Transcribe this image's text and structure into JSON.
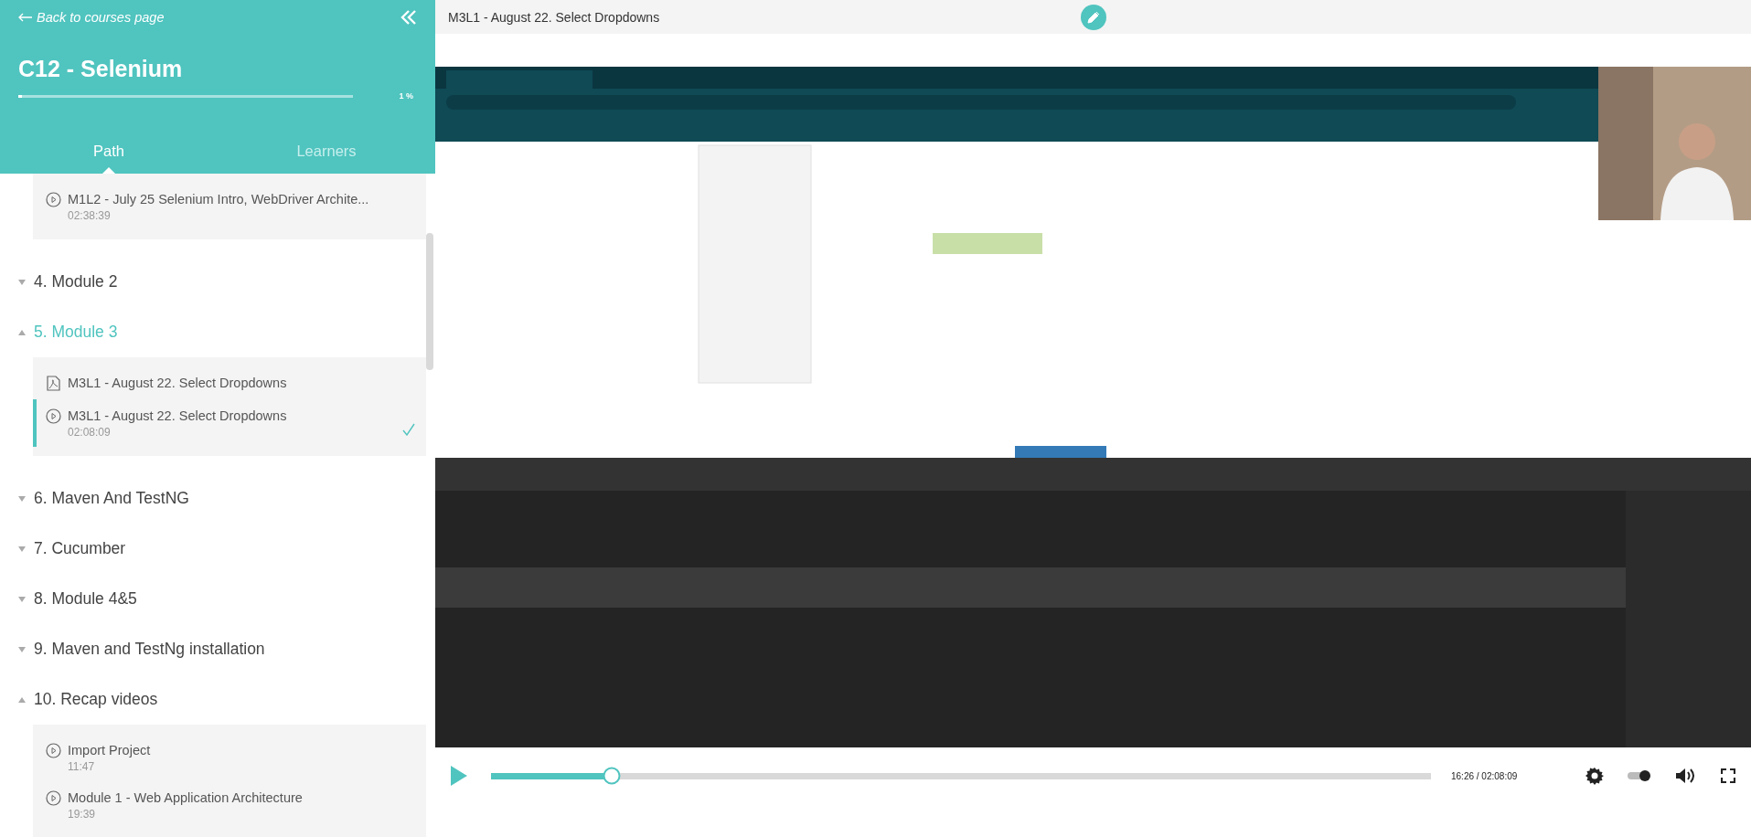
{
  "sidebar": {
    "back_link": "Back to courses page",
    "course_title": "C12 - Selenium",
    "progress": {
      "level": 0.01,
      "reading": "1 %"
    },
    "tabs": [
      {
        "label": "Path",
        "selected": true
      },
      {
        "label": "Learners",
        "selected": false
      }
    ],
    "sections": [
      {
        "kind": "lessons",
        "lessons": [
          {
            "kind": "video",
            "title": "M1L2 - July 25 Selenium Intro, WebDriver Archite...",
            "duration": "02:38:39",
            "current": false,
            "completed": false
          }
        ]
      },
      {
        "kind": "module",
        "title": "4. Module 2",
        "expanded": false,
        "selected": false
      },
      {
        "kind": "module",
        "title": "5. Module 3",
        "expanded": true,
        "selected": true
      },
      {
        "kind": "lessons",
        "lessons": [
          {
            "kind": "pdf",
            "title": "M3L1 - August 22. Select Dropdowns",
            "current": false,
            "completed": false
          },
          {
            "kind": "video",
            "title": "M3L1 - August 22. Select Dropdowns",
            "duration": "02:08:09",
            "current": true,
            "completed": true
          }
        ]
      },
      {
        "kind": "module",
        "title": "6. Maven And TestNG",
        "expanded": false,
        "selected": false
      },
      {
        "kind": "module",
        "title": "7. Cucumber",
        "expanded": false,
        "selected": false
      },
      {
        "kind": "module",
        "title": "8. Module 4&5",
        "expanded": false,
        "selected": false
      },
      {
        "kind": "module",
        "title": "9. Maven and TestNg installation",
        "expanded": false,
        "selected": false
      },
      {
        "kind": "module",
        "title": "10. Recap videos",
        "expanded": true,
        "selected": false
      },
      {
        "kind": "lessons",
        "lessons": [
          {
            "kind": "video",
            "title": "Import Project",
            "duration": "11:47",
            "current": false,
            "completed": false
          },
          {
            "kind": "video",
            "title": "Module 1 - Web Application Architecture",
            "duration": "19:39",
            "current": false,
            "completed": false
          }
        ]
      }
    ]
  },
  "lesson": {
    "title": "M3L1 - August 22. Select Dropdowns"
  },
  "player": {
    "playing": false,
    "autoplay": {
      "on": true
    },
    "level": 0.128,
    "time": "16:26 / 02:08:09"
  }
}
